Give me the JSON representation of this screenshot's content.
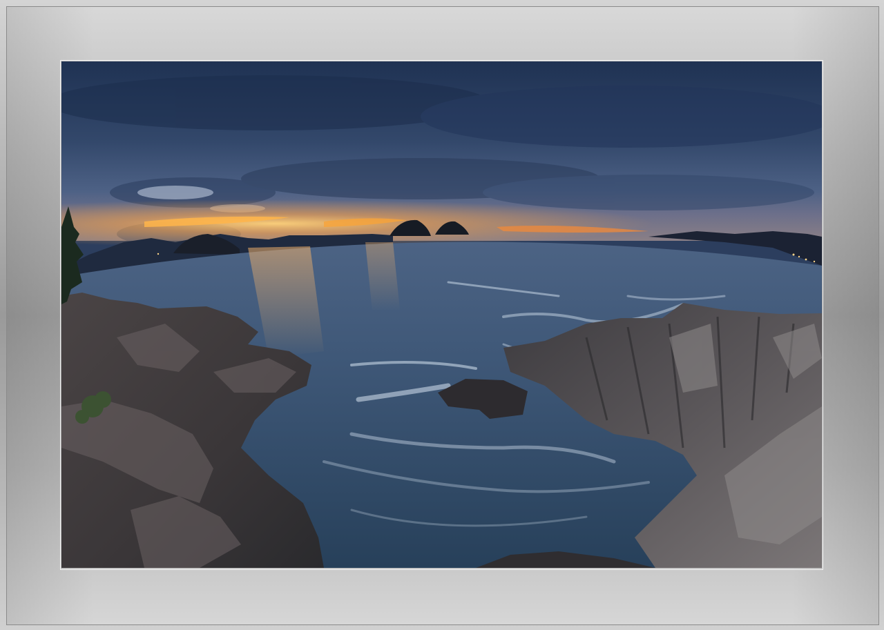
{
  "scene": {
    "subject": "coastal-sunset-fisheye",
    "colors": {
      "sky_top": "#233758",
      "sky_mid": "#3b5072",
      "horizon_glow": "#f0a63a",
      "sea": "#3d5677",
      "rock": "#4b4a4d",
      "frame": "#b5b5b5"
    }
  }
}
